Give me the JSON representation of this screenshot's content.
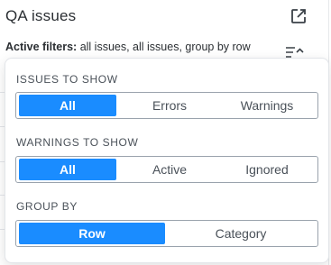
{
  "panel": {
    "title": "QA issues",
    "active_filters_label": "Active filters:",
    "active_filters_value": "all issues, all issues, group by row"
  },
  "popover": {
    "issues_to_show": {
      "label": "ISSUES TO SHOW",
      "options": [
        "All",
        "Errors",
        "Warnings"
      ],
      "selected": "All"
    },
    "warnings_to_show": {
      "label": "WARNINGS TO SHOW",
      "options": [
        "All",
        "Active",
        "Ignored"
      ],
      "selected": "All"
    },
    "group_by": {
      "label": "GROUP BY",
      "options": [
        "Row",
        "Category"
      ],
      "selected": "Row"
    }
  },
  "colors": {
    "accent": "#1a8cff",
    "border": "#9aa3ad",
    "text": "#4a5159"
  },
  "icons": {
    "open_external": "external-link-icon",
    "sort_toggle": "sort-collapse-icon"
  }
}
